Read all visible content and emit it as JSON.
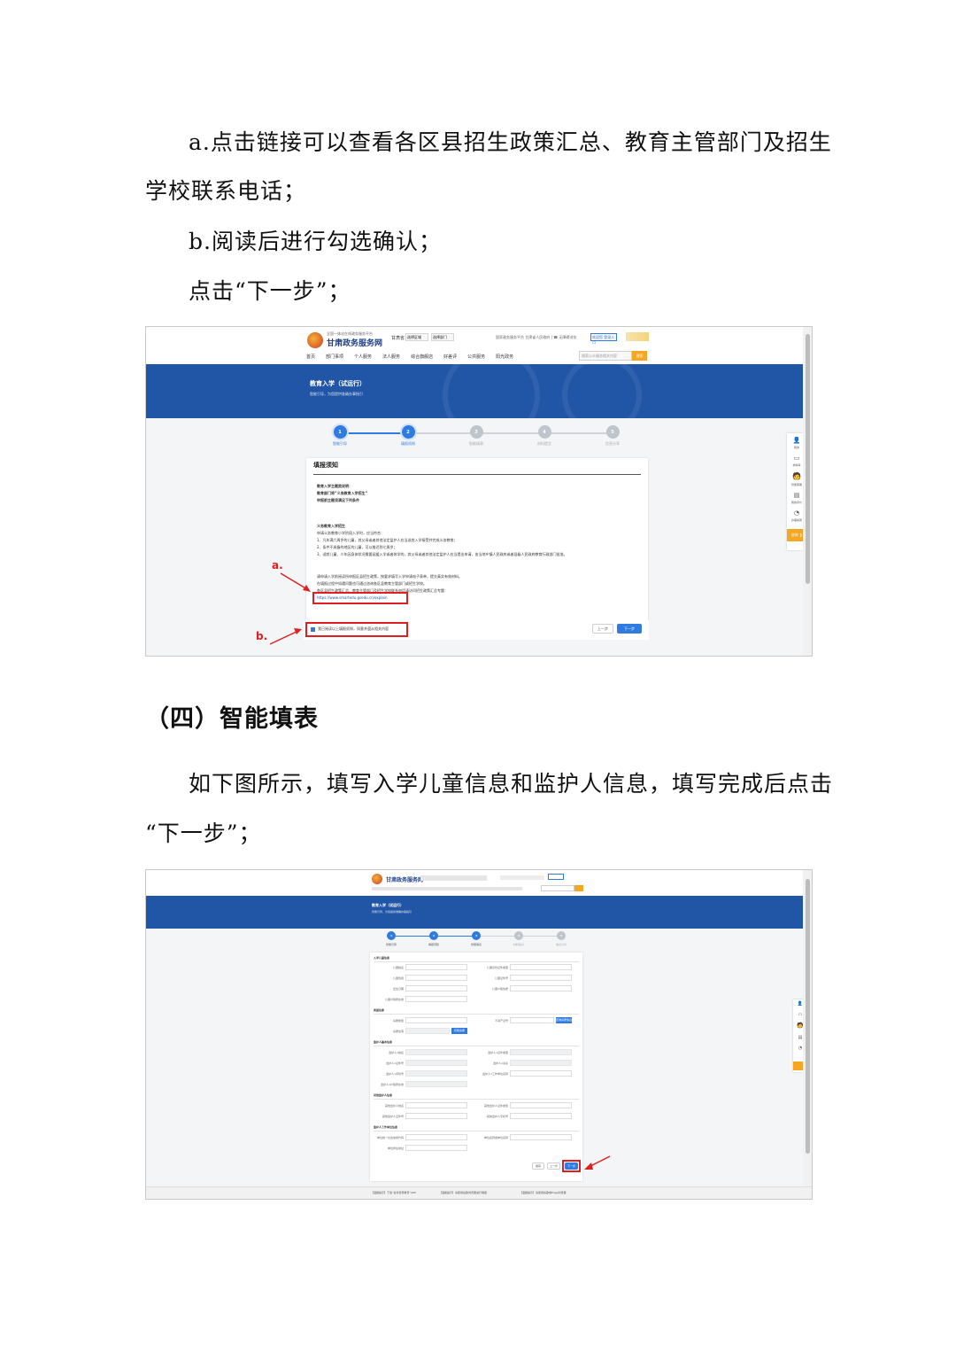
{
  "doc": {
    "p1_line1": "a.点击链接可以查看各区县招生政策汇总、教育主管部门及招生",
    "p1_line2": "学校联系电话；",
    "p2": "b.阅读后进行勾选确认；",
    "p3": "点击“下一步”；",
    "heading": "（四）智能填表",
    "p4_line1": "如下图所示，填写入学儿童信息和监护人信息，填写完成后点击",
    "p4_line2": "“下一步”；"
  },
  "shot1": {
    "logo_top": "全国一体化在线政务服务平台",
    "logo": "甘肃政务服务网",
    "region": "甘肃省",
    "region_select": "选择区域",
    "dept_select": "选择部门",
    "top_links": "国家政务服务平台  甘肃省人民政府  |  ☎ 无障碍浏览",
    "login": "欢迎您  登录入口",
    "nav": [
      "首页",
      "部门事项",
      "个人服务",
      "法人服务",
      "综合旗舰店",
      "好差评",
      "公共服务",
      "阳光政务"
    ],
    "search_placeholder": "搜索公众服务相关内容",
    "search_btn": "搜索",
    "banner_title": "教育入学（试运行）",
    "banner_sub": "智能引导，为您提供准确办事指引",
    "steps": [
      {
        "n": "1",
        "label": "智能引导"
      },
      {
        "n": "2",
        "label": "填报须知"
      },
      {
        "n": "3",
        "label": "智能填表"
      },
      {
        "n": "4",
        "label": "材料提交"
      },
      {
        "n": "5",
        "label": "信息分享"
      }
    ],
    "card_title": "填报须知",
    "notice_head": [
      "教育入学主题类说明：",
      "教育部门将“义务教育入学招生”",
      "申报前主题须满足下列条件"
    ],
    "section_title": "义务教育入学招生",
    "body_lines": [
      "申请义务教育小学阶段入学时，应当符合：",
      "1、凡年满六周岁的儿童，其父母或者其他法定监护人应当送其入学接受并完成义务教育；",
      "2、条件不具备的地区的儿童，可以推迟到七周岁；",
      "3、适龄儿童、少年因身体状况需要延缓入学或者休学的，其父母或者其他法定监护人应当提出申请，由当地乡镇人民政府或者县级人民政府教育行政部门批准。",
      "",
      "请申请入学前阅读所申报区县招生政策，按要求填写入学申请电子表单，提交真实有效材料。",
      "在填报过程中如遇问题也可通过咨询各区县教育主管部门或招生学校。",
      "各区县招生政策汇总、教育主管部门及招生学校联系电话请访问招生政策汇总专题："
    ],
    "link": "https://www.smartedu.gsedu.cn/explain",
    "confirm": "我已阅读以上填报须知，同意并遵从相关内容",
    "prev": "上一步",
    "next": "下一步",
    "anno_a": "a.",
    "anno_b": "b.",
    "side_items": [
      "我的",
      "材料库",
      "智能客服",
      "我的评价",
      "办事指南"
    ],
    "side_btn": "咨询 ❯"
  },
  "shot2": {
    "logo": "甘肃政务服务网",
    "banner_title": "教育入学（试运行）",
    "banner_sub": "智能引导，为您提供准确办事指引",
    "steps": [
      {
        "n": "1",
        "label": "智能引导"
      },
      {
        "n": "2",
        "label": "填报须知"
      },
      {
        "n": "3",
        "label": "智能填表"
      },
      {
        "n": "4",
        "label": "材料提交"
      },
      {
        "n": "5",
        "label": "信息分享"
      }
    ],
    "sec1": "入学儿童信息",
    "sec1_left": [
      "儿童姓名",
      "儿童性别",
      "出生日期",
      "儿童户籍所在地"
    ],
    "sec1_right": [
      "儿童身份证件类型",
      "儿童证件号",
      "儿童户籍性质"
    ],
    "sec2": "房屋信息",
    "sec2_left": [
      "房屋类型",
      "房屋坐落"
    ],
    "sec2_right": [
      "不动产证号"
    ],
    "sec2_btn": "获取房屋",
    "sec2_btn2": "查询房屋信息",
    "sec3": "监护人基本信息",
    "sec3_left": [
      "监护人1姓名",
      "监护人1证件号",
      "监护人1手机号",
      "监护人1户籍所在地"
    ],
    "sec3_right": [
      "监护人1证件类型",
      "监护人1关系",
      "监护人1工作单位名称"
    ],
    "sec4": "其他监护人信息",
    "sec4_left": [
      "其他监护人姓名",
      "其他监护人证件号"
    ],
    "sec4_right": [
      "其他监护人证件类型",
      "其他监护人手机号"
    ],
    "sec5": "监护人工作单位信息",
    "sec5_left": [
      "单位统一社会信用代码",
      "单位所在地址"
    ],
    "sec5_right": [
      "单位名称或单位名称"
    ],
    "btn_save": "保存",
    "btn_prev": "上一步",
    "btn_next": "下一步",
    "footer": [
      "【温馨提示】下载“甘肃智慧教育”APP",
      "【温馨提示】请使用谷歌浏览器进行填报",
      "【温馨提示】请使用谷歌或Edge浏览器"
    ]
  }
}
